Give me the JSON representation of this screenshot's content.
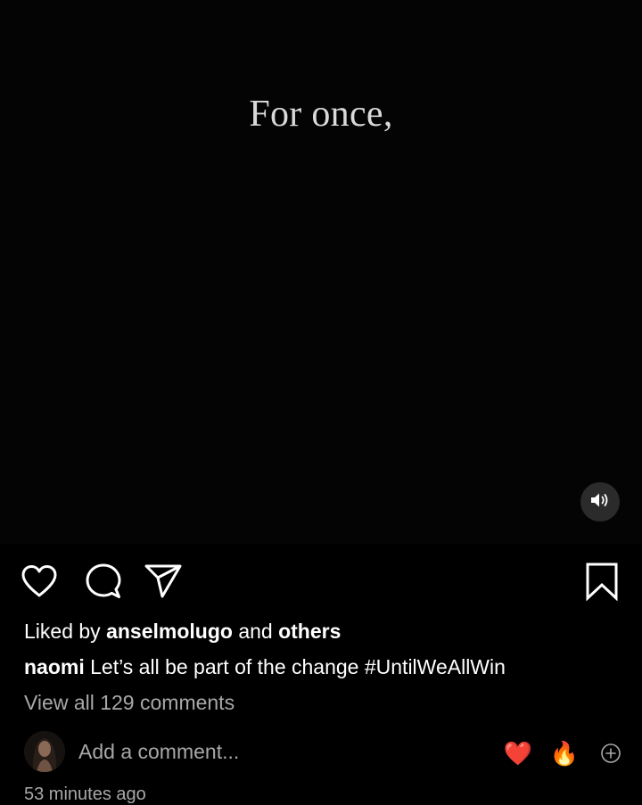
{
  "video": {
    "caption": "For once,"
  },
  "icons": {
    "volume": "volume-icon",
    "like": "heart-icon",
    "comment": "comment-bubble-icon",
    "share": "paper-plane-icon",
    "save": "bookmark-icon",
    "add": "add-circle-icon"
  },
  "likes": {
    "prefix": "Liked by",
    "user": "anselmolugo",
    "joiner": "and",
    "others": "others"
  },
  "caption": {
    "username": "naomi",
    "text": "Let’s all be part of the change #UntilWeAllWin"
  },
  "comments": {
    "view_all": "View all 129 comments"
  },
  "comment_box": {
    "placeholder": "Add a comment...",
    "quick_reactions": [
      "❤️",
      "🔥"
    ]
  },
  "timestamp": "53 minutes ago",
  "colors": {
    "background": "#000000",
    "text": "#ffffff",
    "secondary_text": "#a8a8a8",
    "caption_text": "#d9d9d9"
  }
}
